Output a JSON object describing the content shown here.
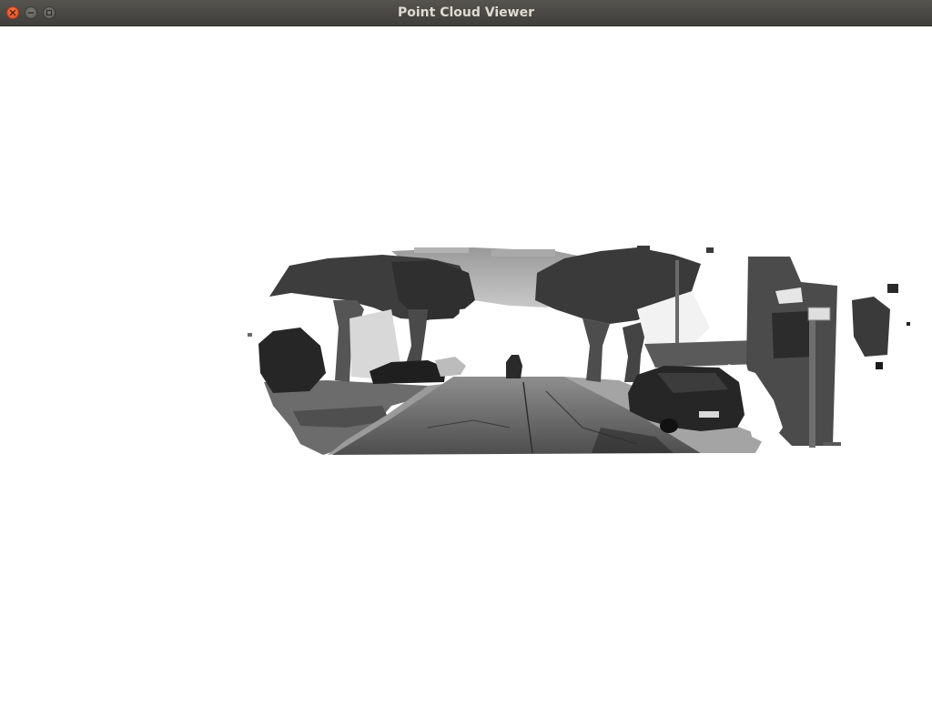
{
  "window": {
    "title": "Point Cloud Viewer"
  },
  "titlebar_buttons": {
    "close_icon": "close-icon",
    "minimize_icon": "minimize-icon",
    "maximize_icon": "maximize-icon"
  },
  "colors": {
    "titlebar": "#4a4945",
    "title_text": "#dfdbd2",
    "close_button": "#e95420",
    "viewport_background": "#ffffff"
  }
}
